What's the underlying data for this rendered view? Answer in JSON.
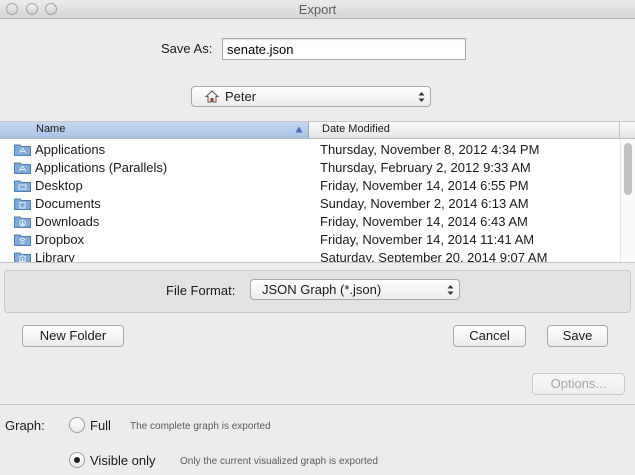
{
  "window": {
    "title": "Export"
  },
  "save_as": {
    "label": "Save As:",
    "value": "senate.json"
  },
  "location": {
    "label": "Peter",
    "icon": "home-icon"
  },
  "browser": {
    "columns": {
      "name": "Name",
      "date": "Date Modified"
    },
    "rows": [
      {
        "name": "Applications",
        "date": "Thursday, November 8, 2012 4:34 PM",
        "icon": "applications-folder-icon"
      },
      {
        "name": "Applications (Parallels)",
        "date": "Thursday, February 2, 2012 9:33 AM",
        "icon": "applications-folder-icon"
      },
      {
        "name": "Desktop",
        "date": "Friday, November 14, 2014 6:55 PM",
        "icon": "desktop-folder-icon"
      },
      {
        "name": "Documents",
        "date": "Sunday, November 2, 2014 6:13 AM",
        "icon": "documents-folder-icon"
      },
      {
        "name": "Downloads",
        "date": "Friday, November 14, 2014 6:43 AM",
        "icon": "downloads-folder-icon"
      },
      {
        "name": "Dropbox",
        "date": "Friday, November 14, 2014 11:41 AM",
        "icon": "dropbox-folder-icon"
      },
      {
        "name": "Library",
        "date": "Saturday, September 20, 2014 9:07 AM",
        "icon": "library-folder-icon"
      }
    ]
  },
  "file_format": {
    "label": "File Format:",
    "value": "JSON Graph (*.json)"
  },
  "buttons": {
    "new_folder": "New Folder",
    "cancel": "Cancel",
    "save": "Save",
    "options": "Options..."
  },
  "graph": {
    "label": "Graph:",
    "options": [
      {
        "label": "Full",
        "description": "The complete graph is exported",
        "selected": false
      },
      {
        "label": "Visible only",
        "description": "Only the current visualized graph is exported",
        "selected": true
      }
    ]
  },
  "colors": {
    "header_selected": "#b8cdee",
    "folder_blue": "#7fa9d6",
    "disabled_text": "#a7a7a7"
  }
}
